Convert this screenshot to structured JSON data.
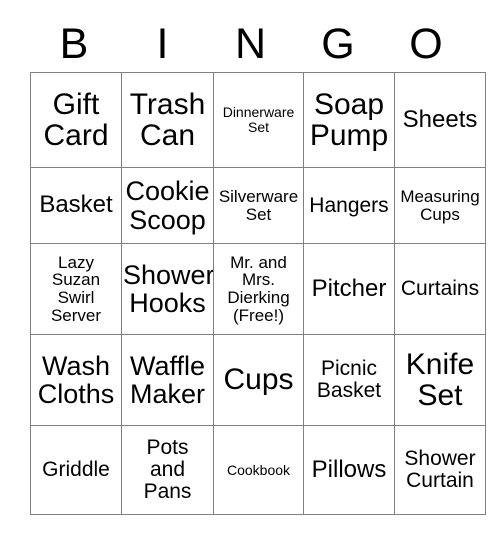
{
  "card": {
    "title_letters": [
      "B",
      "I",
      "N",
      "G",
      "O"
    ],
    "grid": {
      "columns": 5,
      "rows": 5,
      "border_color": "#808080",
      "text_color": "#000000",
      "background_color": "#ffffff",
      "cells": [
        [
          {
            "text": "Gift\nCard",
            "size": "xxl"
          },
          {
            "text": "Trash\nCan",
            "size": "xxl"
          },
          {
            "text": "Dinnerware\nSet",
            "size": "xs"
          },
          {
            "text": "Soap\nPump",
            "size": "xxl"
          },
          {
            "text": "Sheets",
            "size": "l"
          }
        ],
        [
          {
            "text": "Basket",
            "size": "l"
          },
          {
            "text": "Cookie\nScoop",
            "size": "xl"
          },
          {
            "text": "Silverware\nSet",
            "size": "s"
          },
          {
            "text": "Hangers",
            "size": "m"
          },
          {
            "text": "Measuring\nCups",
            "size": "s"
          }
        ],
        [
          {
            "text": "Lazy\nSuzan\nSwirl\nServer",
            "size": "s"
          },
          {
            "text": "Shower\nHooks",
            "size": "xl"
          },
          {
            "text": "Mr. and\nMrs.\nDierking\n(Free!)",
            "size": "s"
          },
          {
            "text": "Pitcher",
            "size": "l"
          },
          {
            "text": "Curtains",
            "size": "m"
          }
        ],
        [
          {
            "text": "Wash\nCloths",
            "size": "xl"
          },
          {
            "text": "Waffle\nMaker",
            "size": "xl"
          },
          {
            "text": "Cups",
            "size": "xxl"
          },
          {
            "text": "Picnic\nBasket",
            "size": "m"
          },
          {
            "text": "Knife\nSet",
            "size": "xxl"
          }
        ],
        [
          {
            "text": "Griddle",
            "size": "m"
          },
          {
            "text": "Pots\nand\nPans",
            "size": "m"
          },
          {
            "text": "Cookbook",
            "size": "xs"
          },
          {
            "text": "Pillows",
            "size": "l"
          },
          {
            "text": "Shower\nCurtain",
            "size": "m"
          }
        ]
      ]
    }
  }
}
